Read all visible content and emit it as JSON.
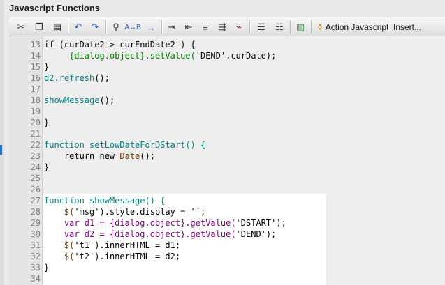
{
  "window": {
    "title": "Javascript Functions"
  },
  "toolbar": {
    "buttons": [
      {
        "icon": "cut-icon",
        "glyph": "✂"
      },
      {
        "icon": "copy-icon",
        "glyph": "❐"
      },
      {
        "icon": "paste-icon",
        "glyph": "📋"
      },
      {
        "icon": "undo-icon",
        "glyph": "↶"
      },
      {
        "icon": "redo-icon",
        "glyph": "↷"
      },
      {
        "icon": "find-icon",
        "glyph": "🔍"
      },
      {
        "icon": "replace-icon",
        "glyph": "A↔B"
      },
      {
        "icon": "goto-icon",
        "glyph": "→"
      },
      {
        "icon": "indent-icon",
        "glyph": "⇥"
      },
      {
        "icon": "outdent-icon",
        "glyph": "⇤"
      },
      {
        "icon": "format-icon",
        "glyph": "≡"
      },
      {
        "icon": "align-right-icon",
        "glyph": "⇶"
      },
      {
        "icon": "bookmark-icon",
        "glyph": "⌁"
      },
      {
        "icon": "list-icon",
        "glyph": "☰"
      },
      {
        "icon": "list-settings-icon",
        "glyph": "☷"
      },
      {
        "icon": "book-icon",
        "glyph": "📖"
      }
    ],
    "action_label": "Action Javascript",
    "insert_label": "Insert..."
  },
  "code_lines": [
    {
      "n": "13",
      "segs": [
        {
          "t": "if (curDate2 > curEndDate2 ) {",
          "c": "dark"
        }
      ]
    },
    {
      "n": "14",
      "segs": [
        {
          "t": "     ",
          "c": "dark"
        },
        {
          "t": "{dialog.object}",
          "c": "obj"
        },
        {
          "t": ".setValue(",
          "c": "obj"
        },
        {
          "t": "'DEND'",
          "c": "dark"
        },
        {
          "t": ",curDate);",
          "c": "dark"
        }
      ]
    },
    {
      "n": "15",
      "segs": [
        {
          "t": "}",
          "c": "dark"
        }
      ]
    },
    {
      "n": "16",
      "segs": [
        {
          "t": "d2.refresh",
          "c": "kw"
        },
        {
          "t": "();",
          "c": "dark"
        }
      ]
    },
    {
      "n": "17",
      "segs": []
    },
    {
      "n": "18",
      "segs": [
        {
          "t": "showMessage",
          "c": "kw"
        },
        {
          "t": "();",
          "c": "dark"
        }
      ]
    },
    {
      "n": "19",
      "segs": []
    },
    {
      "n": "20",
      "segs": [
        {
          "t": "}",
          "c": "dark"
        }
      ]
    },
    {
      "n": "21",
      "segs": []
    },
    {
      "n": "22",
      "segs": [
        {
          "t": "function setLowDateForDStart() {",
          "c": "kw"
        }
      ]
    },
    {
      "n": "23",
      "segs": [
        {
          "t": "    return new ",
          "c": "dark"
        },
        {
          "t": "Date",
          "c": "fn"
        },
        {
          "t": "();",
          "c": "dark"
        }
      ]
    },
    {
      "n": "24",
      "segs": [
        {
          "t": "}",
          "c": "dark"
        }
      ]
    },
    {
      "n": "25",
      "segs": []
    },
    {
      "n": "26",
      "segs": []
    },
    {
      "n": "27",
      "segs": [
        {
          "t": "function showMessage() {",
          "c": "kw"
        }
      ]
    },
    {
      "n": "28",
      "segs": [
        {
          "t": "    $(",
          "c": "fn"
        },
        {
          "t": "'msg'",
          "c": "dark"
        },
        {
          "t": ").style.display = ",
          "c": "dark"
        },
        {
          "t": "''",
          "c": "dark"
        },
        {
          "t": ";",
          "c": "dark"
        }
      ]
    },
    {
      "n": "29",
      "segs": [
        {
          "t": "    var d1 = ",
          "c": "purple"
        },
        {
          "t": "{dialog.object}",
          "c": "purple"
        },
        {
          "t": ".getValue(",
          "c": "purple"
        },
        {
          "t": "'DSTART'",
          "c": "dark"
        },
        {
          "t": ");",
          "c": "dark"
        }
      ]
    },
    {
      "n": "30",
      "segs": [
        {
          "t": "    var d2 = ",
          "c": "purple"
        },
        {
          "t": "{dialog.object}",
          "c": "purple"
        },
        {
          "t": ".getValue(",
          "c": "purple"
        },
        {
          "t": "'DEND'",
          "c": "dark"
        },
        {
          "t": ");",
          "c": "dark"
        }
      ]
    },
    {
      "n": "31",
      "segs": [
        {
          "t": "    $(",
          "c": "fn"
        },
        {
          "t": "'t1'",
          "c": "dark"
        },
        {
          "t": ").innerHTML = d1;",
          "c": "dark"
        }
      ]
    },
    {
      "n": "32",
      "segs": [
        {
          "t": "    $(",
          "c": "fn"
        },
        {
          "t": "'t2'",
          "c": "dark"
        },
        {
          "t": ").innerHTML = d2;",
          "c": "dark"
        }
      ]
    },
    {
      "n": "33",
      "segs": [
        {
          "t": "}",
          "c": "dark"
        }
      ]
    },
    {
      "n": "34",
      "segs": []
    }
  ]
}
